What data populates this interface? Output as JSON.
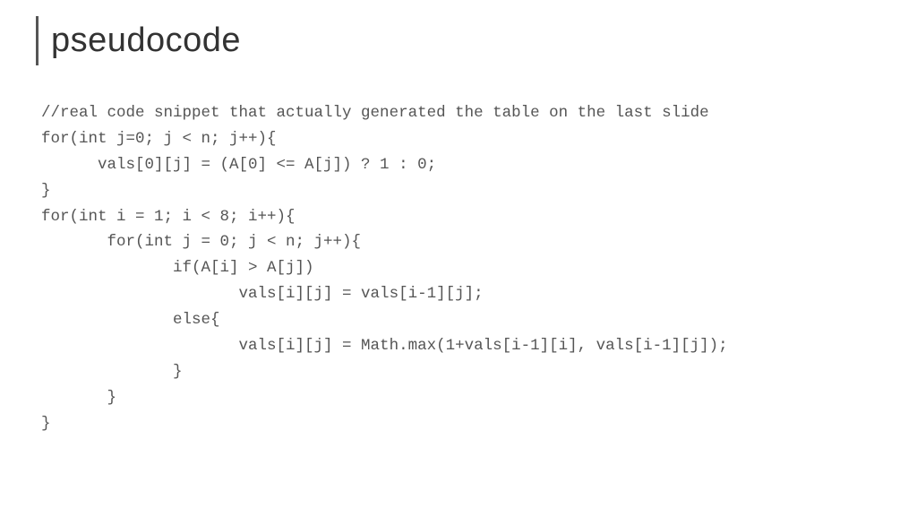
{
  "title": "pseudocode",
  "code": {
    "line1": "//real code snippet that actually generated the table on the last slide",
    "line2": "for(int j=0; j < n; j++){",
    "line3": "      vals[0][j] = (A[0] <= A[j]) ? 1 : 0;",
    "line4": "}",
    "line5": "for(int i = 1; i < 8; i++){",
    "line6": "       for(int j = 0; j < n; j++){",
    "line7": "              if(A[i] > A[j])",
    "line8": "                     vals[i][j] = vals[i-1][j];",
    "line9": "              else{",
    "line10": "                     vals[i][j] = Math.max(1+vals[i-1][i], vals[i-1][j]);",
    "line11": "              }",
    "line12": "       }",
    "line13": "}"
  }
}
